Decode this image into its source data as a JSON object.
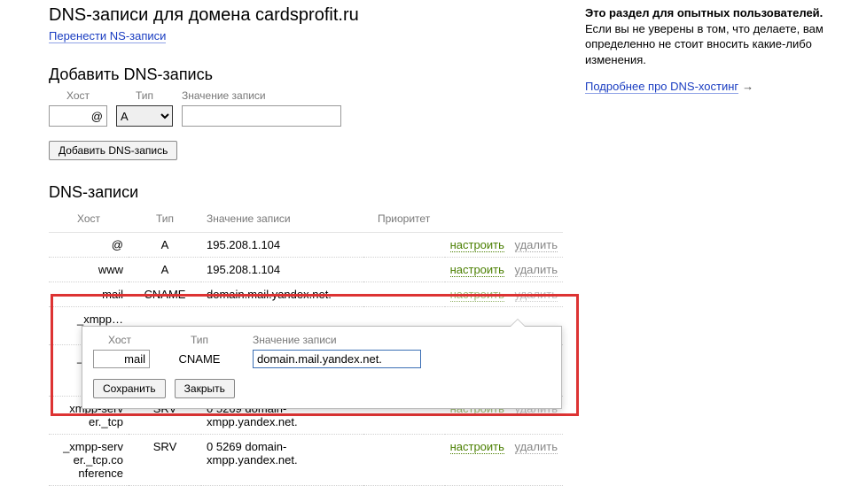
{
  "header": {
    "title": "DNS-записи для домена cardsprofit.ru",
    "transfer_link": "Перенести NS-записи"
  },
  "add": {
    "section_title": "Добавить DNS-запись",
    "host_label": "Хост",
    "type_label": "Тип",
    "value_label": "Значение записи",
    "host_value": "@",
    "type_selected": "A",
    "value_value": "",
    "submit_label": "Добавить DNS-запись"
  },
  "records": {
    "section_title": "DNS-записи",
    "columns": {
      "host": "Хост",
      "type": "Тип",
      "value": "Значение записи",
      "priority": "Приоритет"
    },
    "configure_label": "настроить",
    "delete_label": "удалить",
    "rows": [
      {
        "host": "@",
        "type": "A",
        "value": "195.208.1.104",
        "priority": ""
      },
      {
        "host": "www",
        "type": "A",
        "value": "195.208.1.104",
        "priority": ""
      },
      {
        "host": "mail",
        "type": "CNAME",
        "value": "domain.mail.yandex.net.",
        "priority": ""
      },
      {
        "host": "_xmpp…\nnt.",
        "type": "",
        "value": "",
        "priority": ""
      },
      {
        "host": "_xmpp…\nnt._tc…\nnfere…",
        "type": "",
        "value": "",
        "priority": ""
      },
      {
        "host": "_xmpp-serv\ner._tcp",
        "type": "SRV",
        "value": "0 5269 domain-xmpp.yandex.net.",
        "priority": ""
      },
      {
        "host": "_xmpp-serv\ner._tcp.co\nnference",
        "type": "SRV",
        "value": "0 5269 domain-xmpp.yandex.net.",
        "priority": ""
      }
    ]
  },
  "popover": {
    "host_label": "Хост",
    "type_label": "Тип",
    "value_label": "Значение записи",
    "host_value": "mail",
    "type_value": "CNAME",
    "value_value": "domain.mail.yandex.net.",
    "save_label": "Сохранить",
    "close_label": "Закрыть"
  },
  "aside": {
    "title": "Это раздел для опытных пользователей.",
    "text": "Если вы не уверены в том, что делаете, вам определенно не стоит вносить какие-либо изменения.",
    "link": "Подробнее про DNS-хостинг"
  }
}
